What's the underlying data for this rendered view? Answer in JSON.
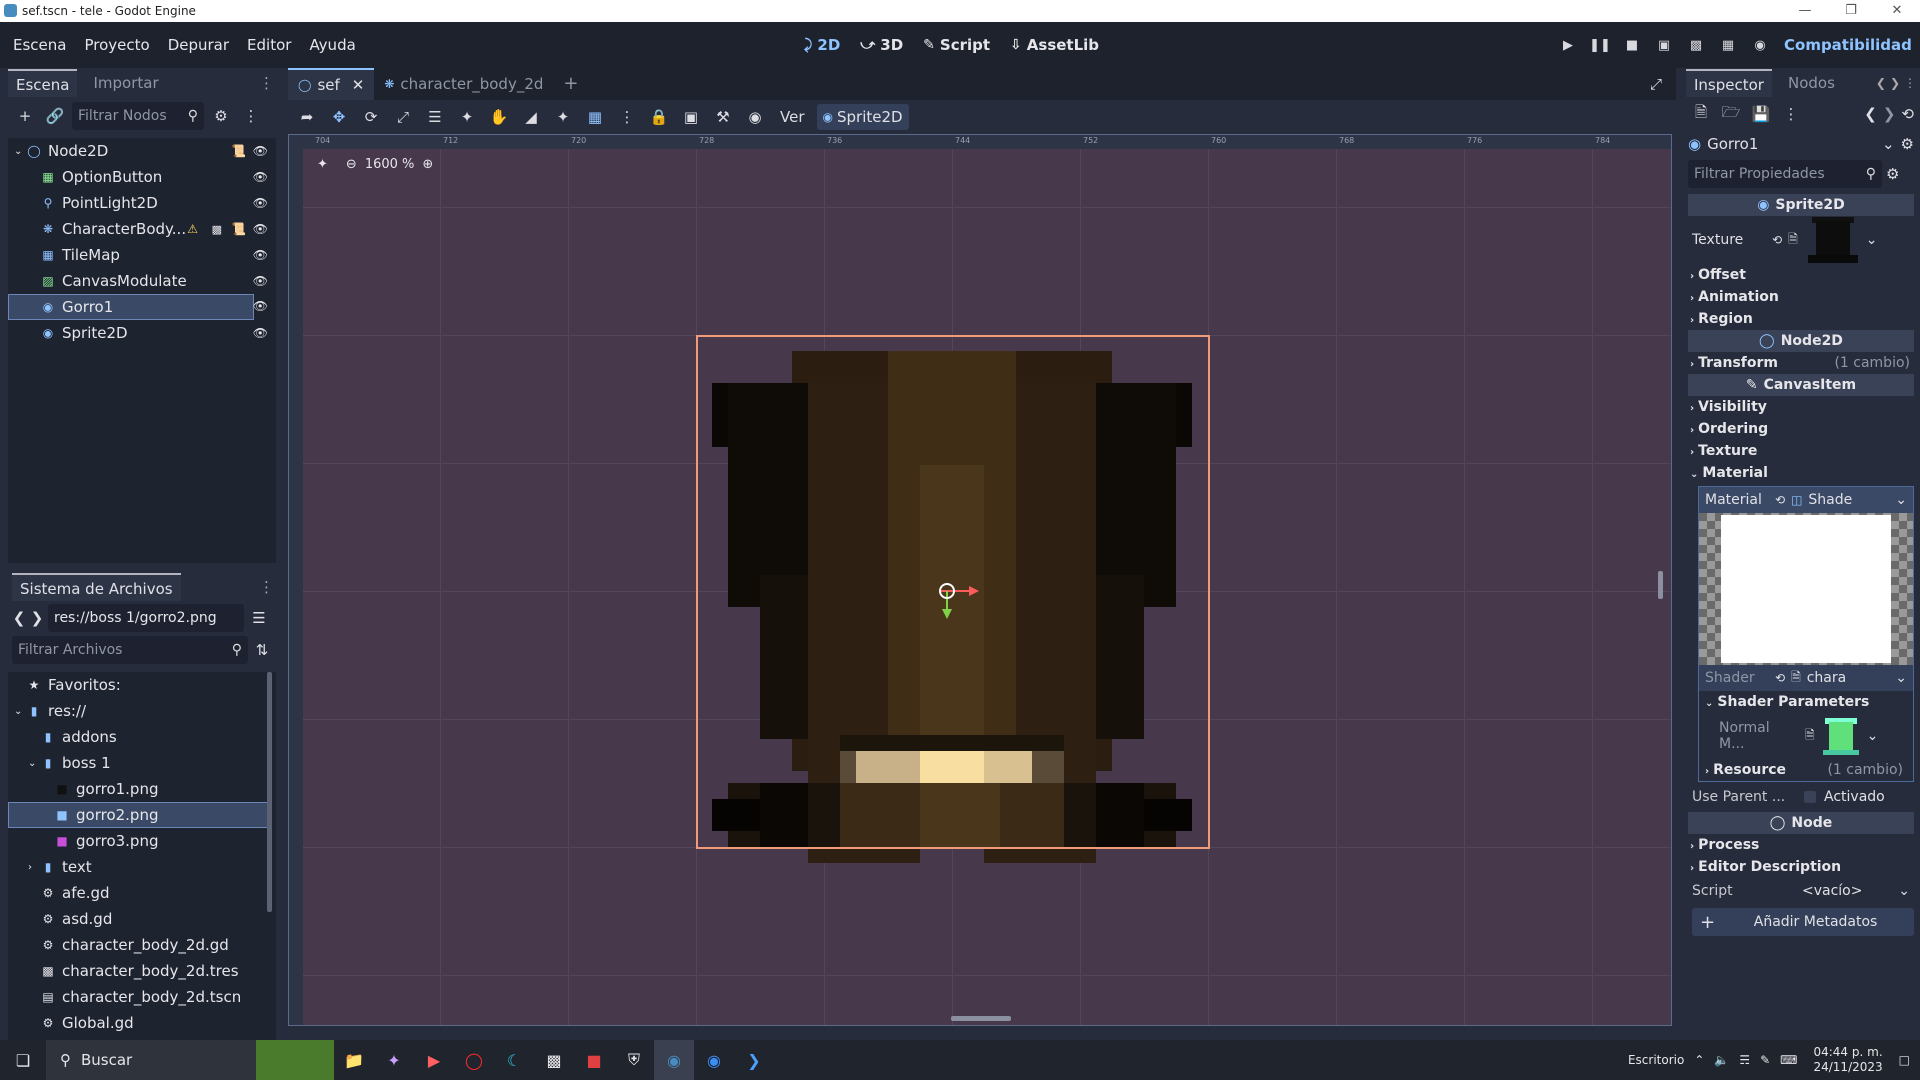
{
  "window": {
    "title": "sef.tscn - tele - Godot Engine"
  },
  "menu": {
    "items": [
      "Escena",
      "Proyecto",
      "Depurar",
      "Editor",
      "Ayuda"
    ]
  },
  "workspaces": {
    "2d": "2D",
    "3d": "3D",
    "script": "Script",
    "assetlib": "AssetLib"
  },
  "renderer": "Compatibilidad",
  "scene_dock": {
    "tabs": [
      "Escena",
      "Importar"
    ],
    "filter_placeholder": "Filtrar Nodos",
    "nodes": [
      {
        "name": "Node2D",
        "icon": "node2d-icon",
        "color": "#8ec3ff"
      },
      {
        "name": "OptionButton",
        "icon": "option-button-icon",
        "color": "#8eef97"
      },
      {
        "name": "PointLight2D",
        "icon": "point-light-icon",
        "color": "#8ec3ff"
      },
      {
        "name": "CharacterBody...",
        "icon": "character-body-icon",
        "color": "#8ec3ff"
      },
      {
        "name": "TileMap",
        "icon": "tilemap-icon",
        "color": "#8ec3ff"
      },
      {
        "name": "CanvasModulate",
        "icon": "canvas-modulate-icon",
        "color": "#8eef97"
      },
      {
        "name": "Gorro1",
        "icon": "sprite-icon",
        "color": "#8ec3ff"
      },
      {
        "name": "Sprite2D",
        "icon": "sprite-icon",
        "color": "#8ec3ff"
      }
    ]
  },
  "fs_dock": {
    "title": "Sistema de Archivos",
    "path": "res://boss 1/gorro2.png",
    "filter_placeholder": "Filtrar Archivos",
    "items": [
      {
        "label": "Favoritos:",
        "indent": 0,
        "icon": "star-icon"
      },
      {
        "label": "res://",
        "indent": 0,
        "icon": "folder-icon"
      },
      {
        "label": "addons",
        "indent": 1,
        "icon": "folder-icon"
      },
      {
        "label": "boss 1",
        "indent": 1,
        "icon": "folder-icon"
      },
      {
        "label": "gorro1.png",
        "indent": 2,
        "icon": "image-icon"
      },
      {
        "label": "gorro2.png",
        "indent": 2,
        "icon": "image-icon"
      },
      {
        "label": "gorro3.png",
        "indent": 2,
        "icon": "image-icon"
      },
      {
        "label": "text",
        "indent": 1,
        "icon": "folder-icon"
      },
      {
        "label": "afe.gd",
        "indent": 1,
        "icon": "gear-icon"
      },
      {
        "label": "asd.gd",
        "indent": 1,
        "icon": "gear-icon"
      },
      {
        "label": "character_body_2d.gd",
        "indent": 1,
        "icon": "gear-icon"
      },
      {
        "label": "character_body_2d.tres",
        "indent": 1,
        "icon": "resource-icon"
      },
      {
        "label": "character_body_2d.tscn",
        "indent": 1,
        "icon": "scene-icon"
      },
      {
        "label": "Global.gd",
        "indent": 1,
        "icon": "gear-icon"
      }
    ]
  },
  "scene_tabs": [
    "sef",
    "character_body_2d"
  ],
  "viewport_toolbar": {
    "view_label": "Ver",
    "selected_node": "Sprite2D"
  },
  "viewport": {
    "zoom": "1600 %",
    "ruler_labels": [
      "704",
      "712",
      "720",
      "728",
      "736",
      "744",
      "752",
      "760",
      "768",
      "776",
      "784"
    ]
  },
  "inspector": {
    "tabs": [
      "Inspector",
      "Nodos"
    ],
    "object": "Gorro1",
    "filter_placeholder": "Filtrar Propiedades",
    "sprite_section": "Sprite2D",
    "texture_label": "Texture",
    "groups_a": [
      "Offset",
      "Animation",
      "Region"
    ],
    "node2d_section": "Node2D",
    "transform_label": "Transform",
    "transform_changes": "(1 cambio)",
    "canvasitem_section": "CanvasItem",
    "groups_b": [
      "Visibility",
      "Ordering",
      "Texture",
      "Material"
    ],
    "material_label": "Material",
    "material_value": "Shade",
    "shader_label": "Shader",
    "shader_value": "chara",
    "shader_params": "Shader Parameters",
    "normal_label": "Normal M...",
    "resource_label": "Resource",
    "resource_changes": "(1 cambio)",
    "use_parent_label": "Use Parent ...",
    "use_parent_value": "Activado",
    "node_section": "Node",
    "groups_c": [
      "Process",
      "Editor Description"
    ],
    "script_label": "Script",
    "script_value": "<vacío>",
    "add_meta": "Añadir Metadatos"
  },
  "taskbar": {
    "search": "Buscar",
    "desktop": "Escritorio",
    "time": "04:44 p. m.",
    "date": "24/11/2023"
  }
}
